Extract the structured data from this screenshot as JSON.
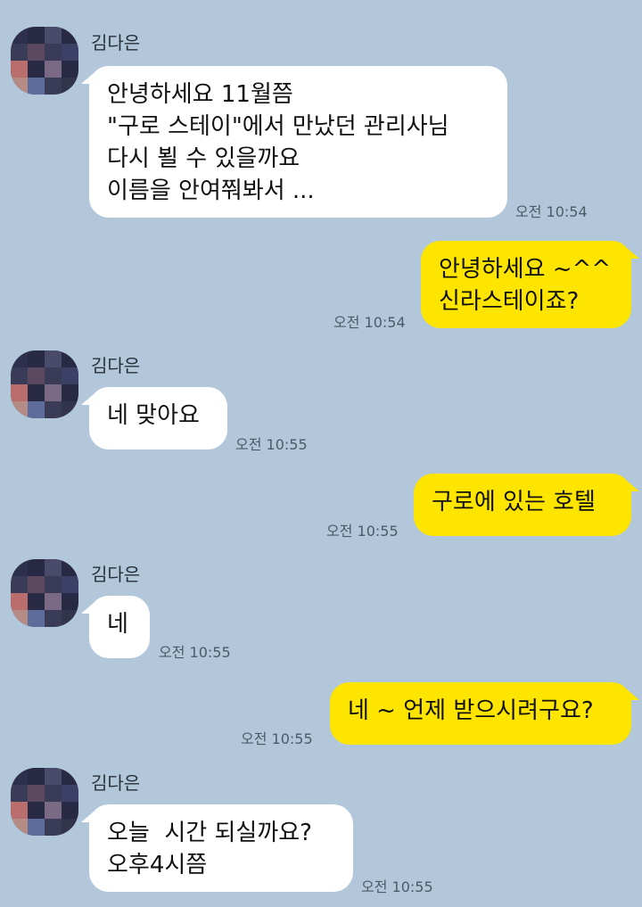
{
  "conversation": {
    "sender_name": "김다은",
    "messages": [
      {
        "from": "them",
        "lines": [
          "안녕하세요 11월쯤",
          "\"구로 스테이\"에서 만났던 관리사님",
          "다시 뵐 수 있을까요",
          "이름을 안여쭤봐서 ..."
        ],
        "time": "오전 10:54"
      },
      {
        "from": "me",
        "lines": [
          "안녕하세요 ~^^",
          "신라스테이죠?"
        ],
        "time": "오전 10:54"
      },
      {
        "from": "them",
        "lines": [
          "네 맞아요"
        ],
        "time": "오전 10:55"
      },
      {
        "from": "me",
        "lines": [
          "구로에 있는 호텔"
        ],
        "time": "오전 10:55"
      },
      {
        "from": "them",
        "lines": [
          "네"
        ],
        "time": "오전 10:55"
      },
      {
        "from": "me",
        "lines": [
          "네 ~ 언제 받으시려구요?"
        ],
        "time": "오전 10:55"
      },
      {
        "from": "them",
        "lines": [
          "오늘  시간 되실까요?",
          "오후4시쯤"
        ],
        "time": "오전 10:55"
      }
    ]
  },
  "colors": {
    "background": "#b2c7da",
    "incoming_bubble": "#ffffff",
    "outgoing_bubble": "#fee500"
  }
}
